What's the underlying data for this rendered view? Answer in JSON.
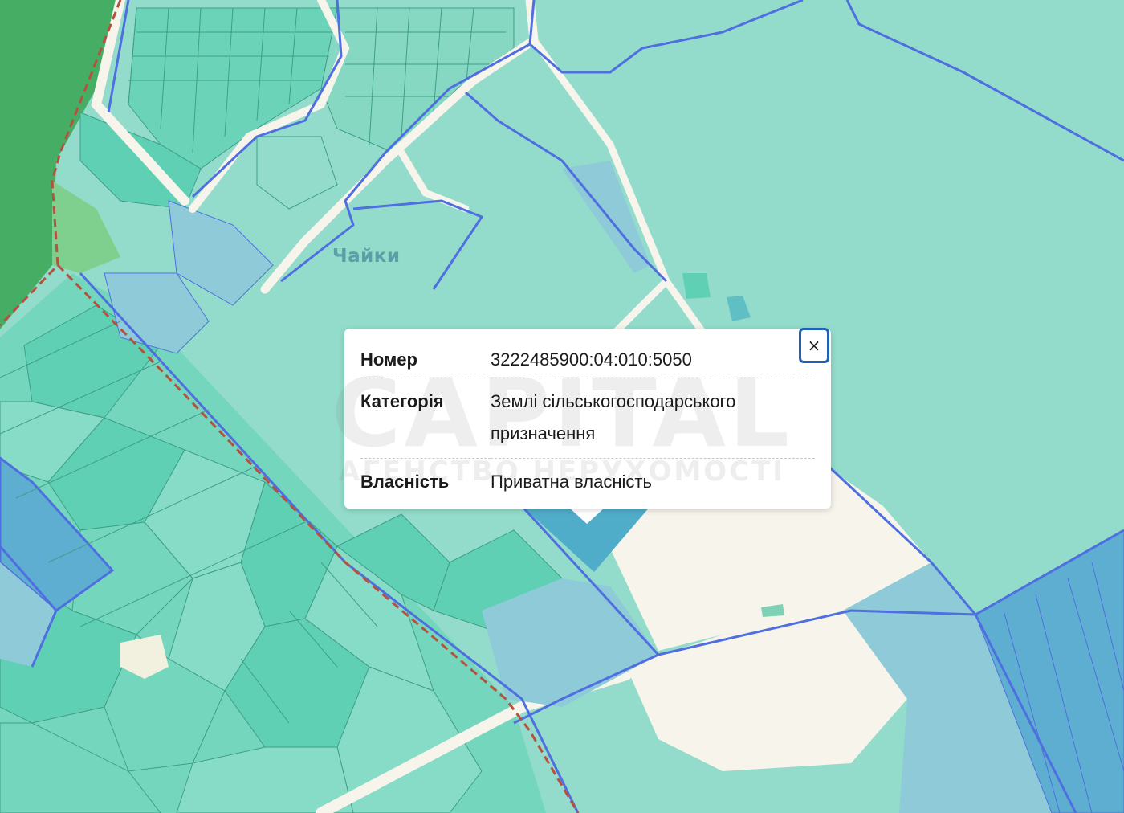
{
  "map": {
    "place_label": "Чайки",
    "colors": {
      "meadow": "#93dccb",
      "parcel_dark": "#5fd0b4",
      "parcel_blue": "#8ecad8",
      "parcel_selected": "#4fadc9",
      "forest": "#45ad64",
      "road": "#f7f4ec",
      "boundary": "#4f6fe0",
      "border_dashed": "#b5513e"
    }
  },
  "popup": {
    "close_label": "×",
    "rows": [
      {
        "key": "Номер",
        "value": "3222485900:04:010:5050"
      },
      {
        "key": "Категорія",
        "value": "Землі сільськогосподарського призначення"
      },
      {
        "key": "Власність",
        "value": "Приватна власність"
      }
    ]
  },
  "watermark": {
    "main": "CAPITAL",
    "sub": "АГЕНСТВО НЕРУХОМОСТІ"
  }
}
